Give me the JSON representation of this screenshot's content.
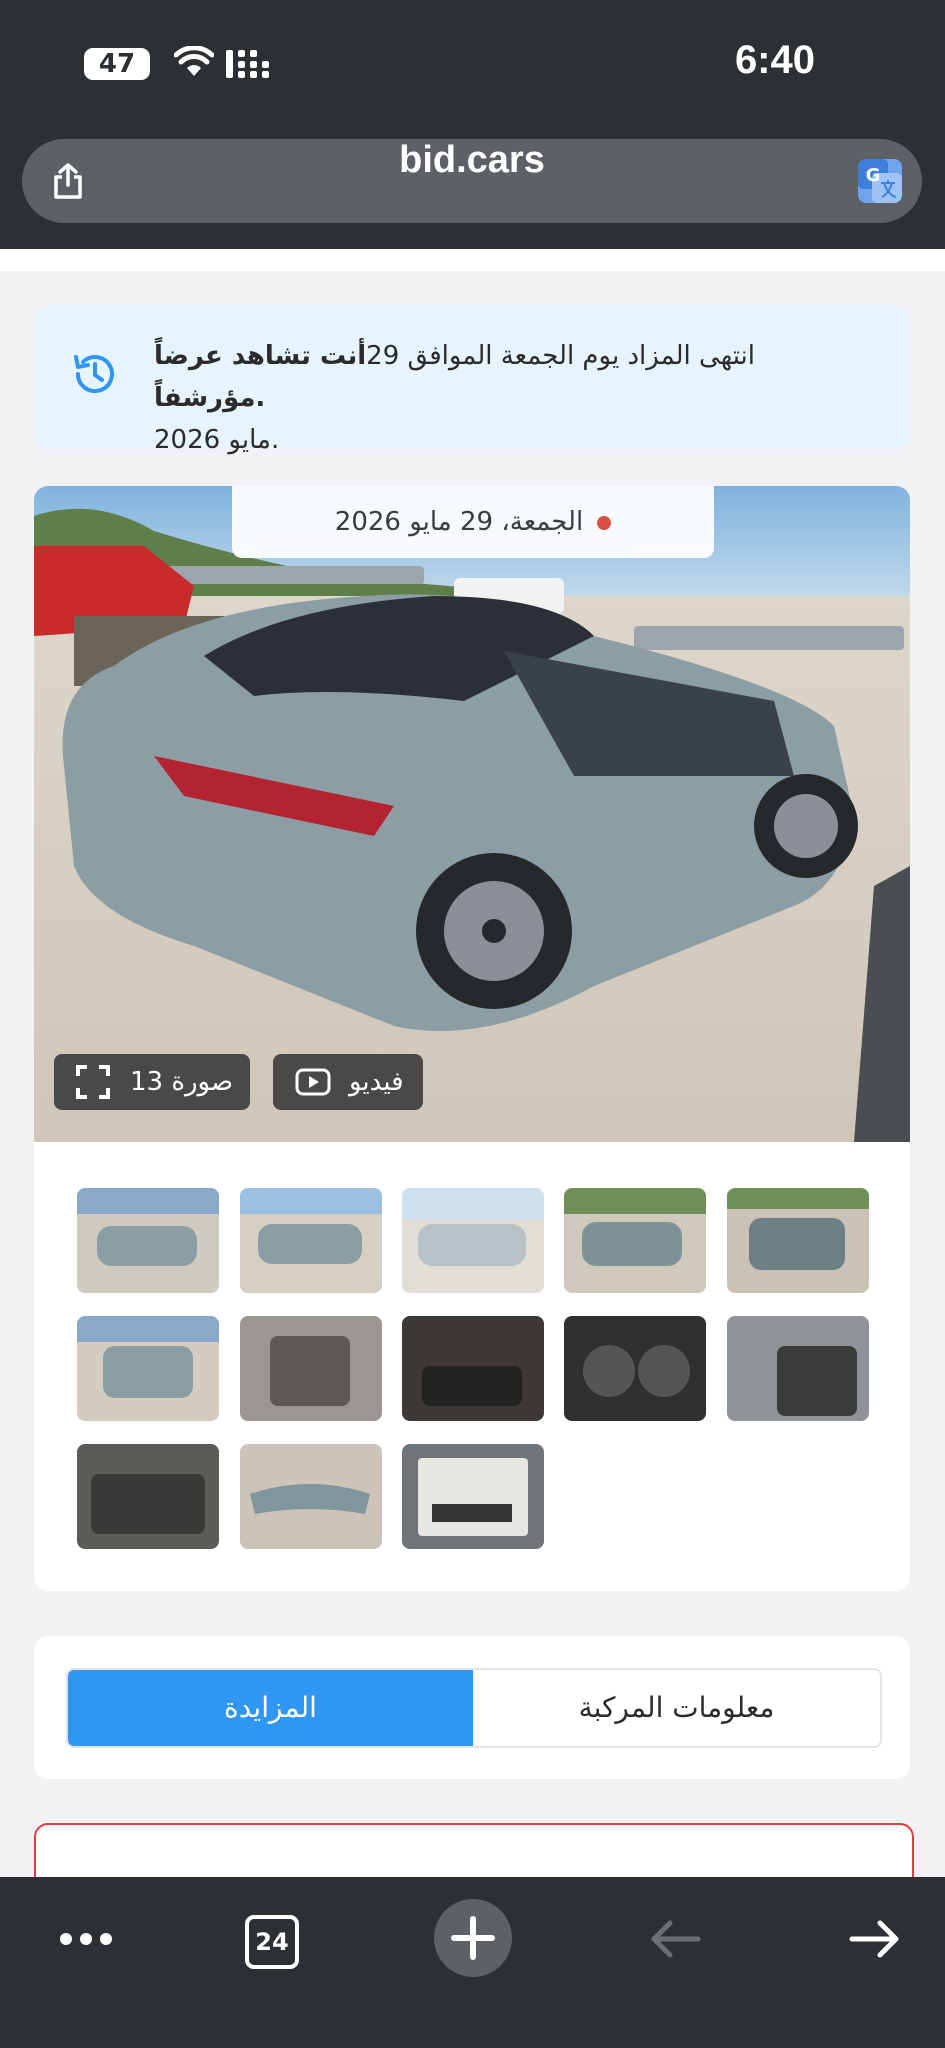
{
  "status_bar": {
    "battery": "47",
    "time": "6:40"
  },
  "browser": {
    "url": "bid.cars",
    "tab_count": "24"
  },
  "notice": {
    "text_plain_1": "انتهى المزاد يوم الجمعة الموافق 29",
    "text_bold": "أنت تشاهد عرضاً مؤرشفاً.",
    "text_plain_2": "مايو 2026."
  },
  "gallery": {
    "date_label": "الجمعة، 29 مايو 2026",
    "photos_label": "13 صورة",
    "video_label": "فيديو",
    "thumbnail_count": 13
  },
  "tabs": {
    "auction_label": "المزايدة",
    "vehicle_info_label": "معلومات المركبة"
  },
  "colors": {
    "accent": "#2f96f2",
    "notice_bg": "#e7f3fd",
    "live_dot": "#e0463d",
    "alert_border": "#e23c3c",
    "chrome": "#2d3033"
  }
}
